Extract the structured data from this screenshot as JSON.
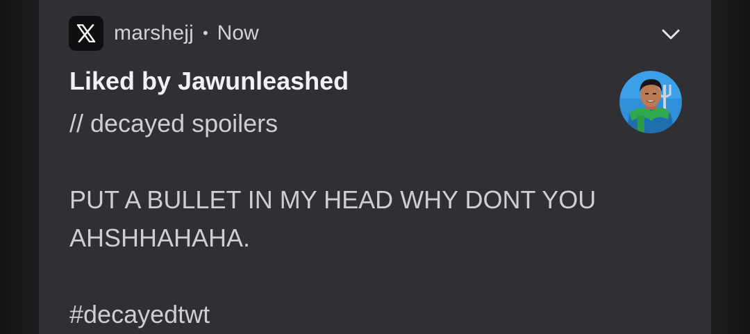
{
  "notification": {
    "app_name": "marshejj",
    "separator": "•",
    "time": "Now",
    "title": "Liked by Jawunleashed",
    "body": "// decayed spoilers\n\nPUT A BULLET IN MY HEAD WHY DONT YOU AHSHHAHAHA.\n\n#decayedtwt",
    "app_icon": "x-logo-icon",
    "expand_icon": "chevron-down-icon",
    "avatar": "profile-avatar"
  },
  "colors": {
    "card_background": "#302f34",
    "title": "#f1f0f3",
    "text": "#cfced3"
  }
}
